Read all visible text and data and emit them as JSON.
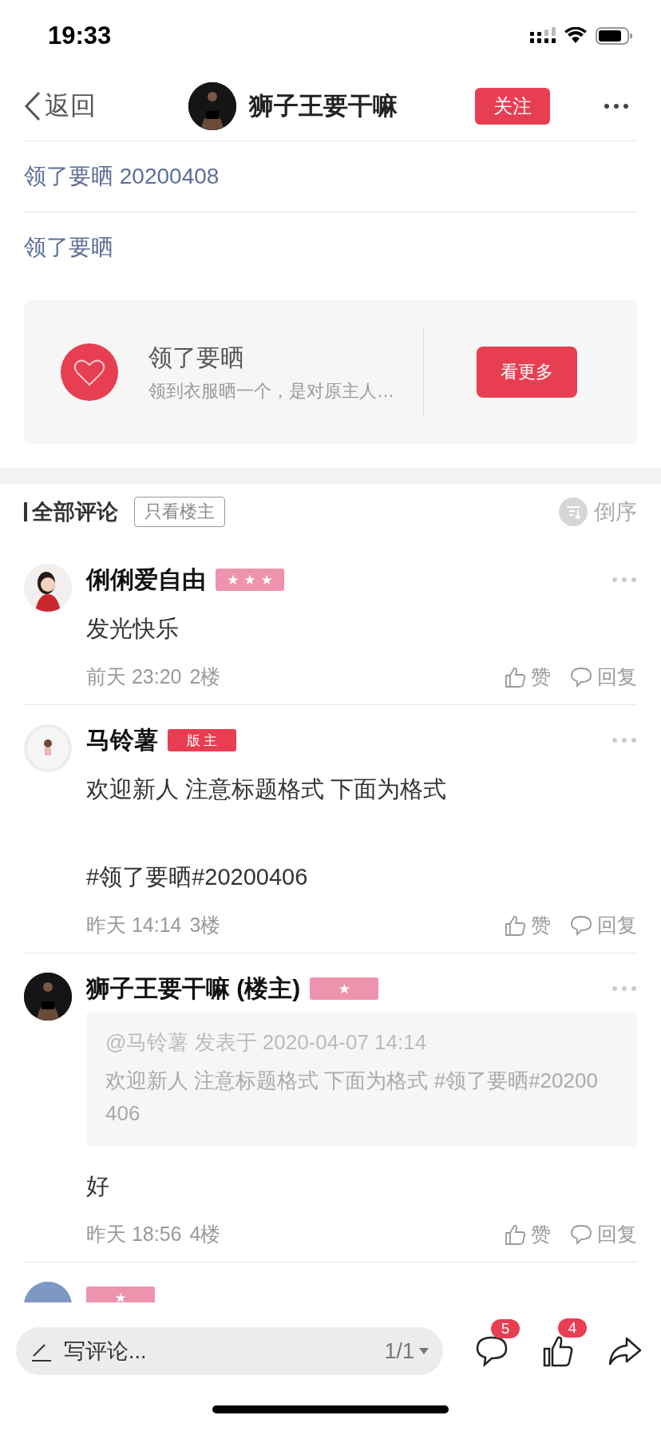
{
  "status_bar": {
    "time": "19:33"
  },
  "nav": {
    "back_label": "返回",
    "title": "狮子王要干嘛",
    "follow_button": "关注"
  },
  "post": {
    "title": "领了要晒 20200408",
    "tag": "领了要晒"
  },
  "topic_card": {
    "title": "领了要晒",
    "description": "领到衣服晒一个，是对原主人…",
    "button": "看更多"
  },
  "comments_header": {
    "title": "全部评论",
    "filter": "只看楼主",
    "sort": "倒序"
  },
  "comments": [
    {
      "name": "俐俐爱自由",
      "badge": {
        "kind": "level",
        "label": "★★★"
      },
      "body": "发光快乐",
      "time": "前天 23:20",
      "floor": "2楼",
      "like": "赞",
      "reply": "回复"
    },
    {
      "name": "马铃薯",
      "badge": {
        "kind": "role",
        "label": "版 主"
      },
      "body": "欢迎新人 注意标题格式 下面为格式\n\n#领了要晒#20200406",
      "time": "昨天 14:14",
      "floor": "3楼",
      "like": "赞",
      "reply": "回复"
    },
    {
      "name": "狮子王要干嘛 (楼主)",
      "badge": {
        "kind": "level",
        "label": "★"
      },
      "quote": {
        "header": "@马铃薯 发表于 2020-04-07 14:14",
        "text": "欢迎新人 注意标题格式 下面为格式 #领了要晒#20200406"
      },
      "body": "好",
      "time": "昨天 18:56",
      "floor": "4楼",
      "like": "赞",
      "reply": "回复"
    },
    {
      "badge": {
        "kind": "level",
        "label": "★"
      }
    }
  ],
  "bottom_bar": {
    "placeholder": "写评论...",
    "page": "1/1",
    "comment_count": "5",
    "like_count": "4"
  }
}
